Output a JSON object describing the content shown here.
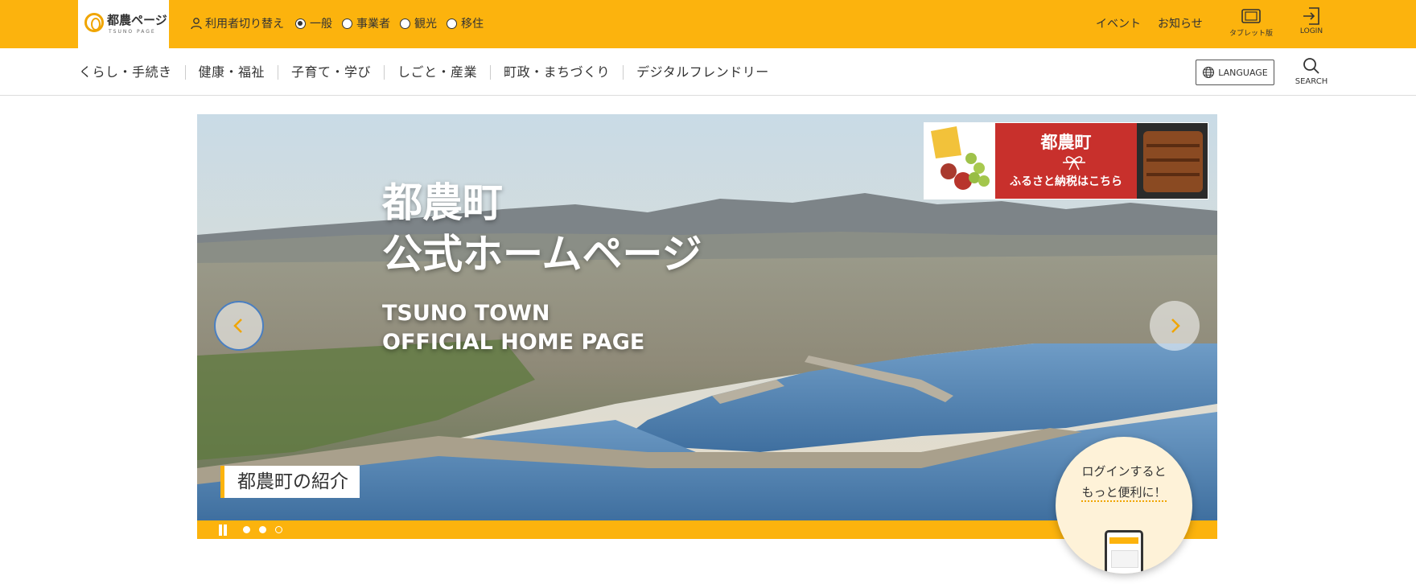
{
  "logo": {
    "main": "都農ページ",
    "sub": "TSUNO PAGE",
    "icon": "tsuno-logo-icon"
  },
  "user_switch": {
    "label": "利用者切り替え",
    "options": [
      {
        "label": "一般",
        "checked": true
      },
      {
        "label": "事業者",
        "checked": false
      },
      {
        "label": "観光",
        "checked": false
      },
      {
        "label": "移住",
        "checked": false
      }
    ]
  },
  "top_links": {
    "event": "イベント",
    "news": "お知らせ"
  },
  "top_buttons": {
    "tablet": "タブレット版",
    "login": "LOGIN"
  },
  "nav": {
    "items": [
      "くらし・手続き",
      "健康・福祉",
      "子育て・学び",
      "しごと・産業",
      "町政・まちづくり",
      "デジタルフレンドリー"
    ],
    "language": "LANGUAGE",
    "search": "SEARCH"
  },
  "hero": {
    "title_line1": "都農町",
    "title_line2": "公式ホームページ",
    "sub_line1": "TSUNO TOWN",
    "sub_line2": "OFFICIAL HOME PAGE",
    "caption": "都農町の紹介",
    "slide_dots": [
      "filled",
      "filled",
      "hollow"
    ]
  },
  "banner": {
    "title": "都農町",
    "text": "ふるさと納税はこちら"
  },
  "login_promo": {
    "line1": "ログインすると",
    "line2": "もっと便利に！"
  },
  "colors": {
    "brand": "#FCB30D",
    "banner_red": "#C8302C",
    "promo_bg": "#FEF2D8"
  }
}
